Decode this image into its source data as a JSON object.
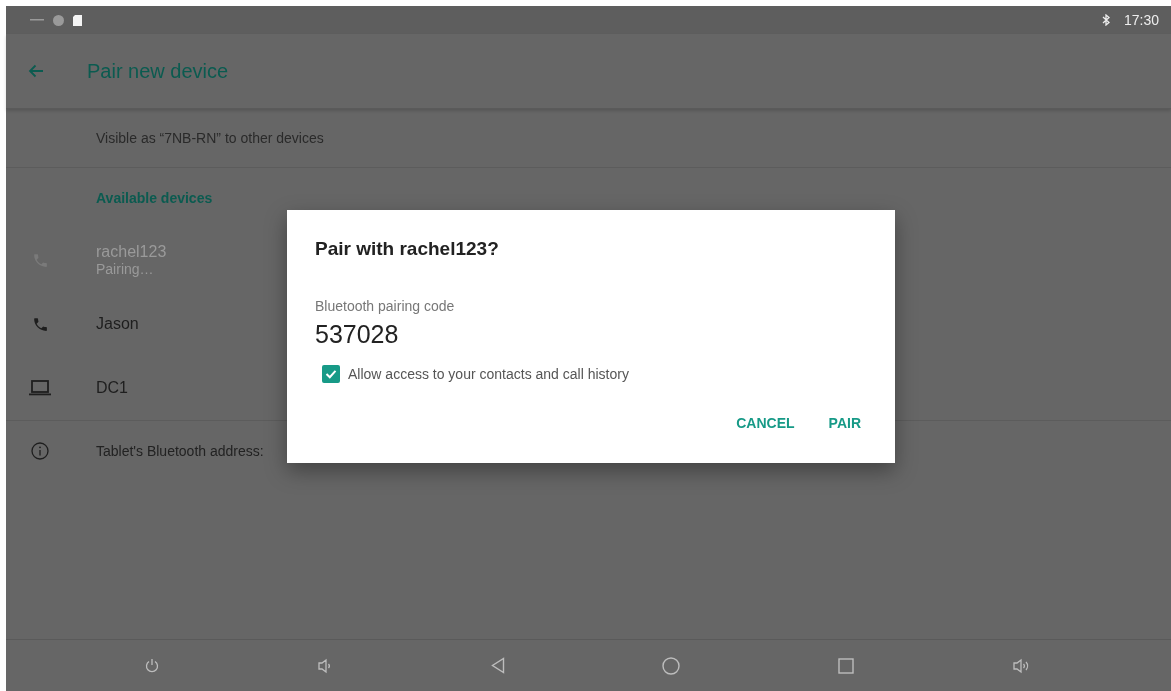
{
  "status_bar": {
    "time": "17:30"
  },
  "app_bar": {
    "title": "Pair new device"
  },
  "visible_as": "Visible as “7NB-RN” to other devices",
  "section_title": "Available devices",
  "devices": [
    {
      "kind": "phone",
      "name": "rachel123",
      "status": "Pairing…",
      "disabled": true
    },
    {
      "kind": "phone",
      "name": "Jason",
      "disabled": false
    },
    {
      "kind": "laptop",
      "name": "DC1",
      "disabled": false
    }
  ],
  "address_info": "Tablet's Bluetooth address:",
  "dialog": {
    "title": "Pair with rachel123?",
    "code_label": "Bluetooth pairing code",
    "code": "537028",
    "checkbox": {
      "label": "Allow access to your contacts and call history",
      "checked": true
    },
    "buttons": [
      "CANCEL",
      "PAIR"
    ]
  }
}
